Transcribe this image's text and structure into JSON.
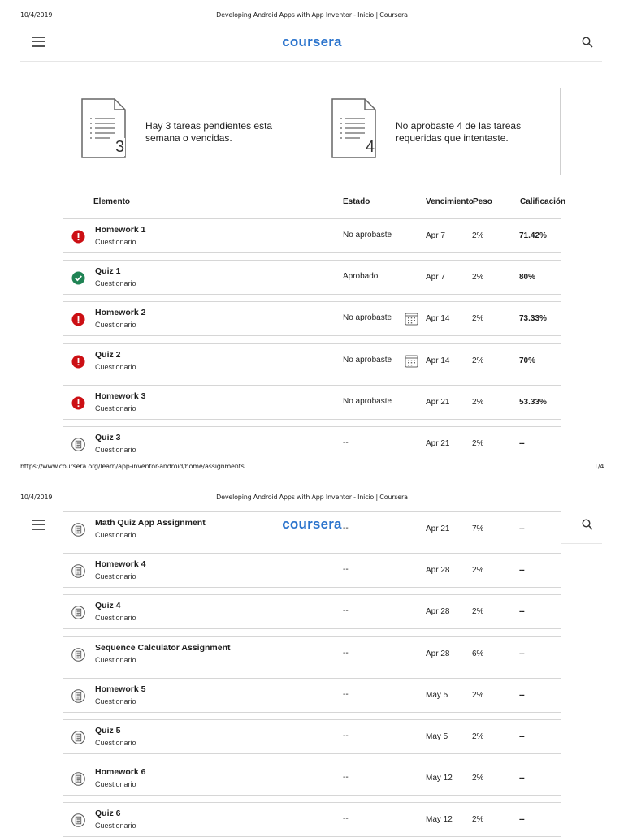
{
  "print": {
    "date": "10/4/2019",
    "title": "Developing Android Apps with App Inventor - Inicio | Coursera",
    "url": "https://www.coursera.org/learn/app-inventor-android/home/assignments",
    "page": "1/4"
  },
  "header": {
    "logo": "coursera"
  },
  "summary": {
    "pending_count": "3",
    "pending_text": "Hay 3 tareas pendientes esta semana o vencidas.",
    "failed_count": "4",
    "failed_text": "No aprobaste 4 de las tareas requeridas que intentaste."
  },
  "table": {
    "headers": {
      "item": "Elemento",
      "status": "Estado",
      "due": "Vencimiento",
      "weight": "Peso",
      "grade": "Calificación"
    },
    "rows_page1": [
      {
        "name": "Homework 1",
        "type": "Cuestionario",
        "status": "No aprobaste",
        "due": "Apr 7",
        "weight": "2%",
        "grade": "71.42%",
        "icon": "fail-icon",
        "calendar": false
      },
      {
        "name": "Quiz 1",
        "type": "Cuestionario",
        "status": "Aprobado",
        "due": "Apr 7",
        "weight": "2%",
        "grade": "80%",
        "icon": "check-icon",
        "calendar": false
      },
      {
        "name": "Homework 2",
        "type": "Cuestionario",
        "status": "No aprobaste",
        "due": "Apr 14",
        "weight": "2%",
        "grade": "73.33%",
        "icon": "fail-icon",
        "calendar": true
      },
      {
        "name": "Quiz 2",
        "type": "Cuestionario",
        "status": "No aprobaste",
        "due": "Apr 14",
        "weight": "2%",
        "grade": "70%",
        "icon": "fail-icon",
        "calendar": true
      },
      {
        "name": "Homework 3",
        "type": "Cuestionario",
        "status": "No aprobaste",
        "due": "Apr 21",
        "weight": "2%",
        "grade": "53.33%",
        "icon": "fail-icon",
        "calendar": false
      },
      {
        "name": "Quiz 3",
        "type": "Cuestionario",
        "status": "--",
        "due": "Apr 21",
        "weight": "2%",
        "grade": "--",
        "icon": "quiz-icon",
        "calendar": false
      }
    ],
    "rows_page2": [
      {
        "name": "Math Quiz App Assignment",
        "type": "Cuestionario",
        "status": "--",
        "due": "Apr 21",
        "weight": "7%",
        "grade": "--",
        "icon": "quiz-icon",
        "calendar": false
      },
      {
        "name": "Homework 4",
        "type": "Cuestionario",
        "status": "--",
        "due": "Apr 28",
        "weight": "2%",
        "grade": "--",
        "icon": "quiz-icon",
        "calendar": false
      },
      {
        "name": "Quiz 4",
        "type": "Cuestionario",
        "status": "--",
        "due": "Apr 28",
        "weight": "2%",
        "grade": "--",
        "icon": "quiz-icon",
        "calendar": false
      },
      {
        "name": "Sequence Calculator Assignment",
        "type": "Cuestionario",
        "status": "--",
        "due": "Apr 28",
        "weight": "6%",
        "grade": "--",
        "icon": "quiz-icon",
        "calendar": false
      },
      {
        "name": "Homework 5",
        "type": "Cuestionario",
        "status": "--",
        "due": "May 5",
        "weight": "2%",
        "grade": "--",
        "icon": "quiz-icon",
        "calendar": false
      },
      {
        "name": "Quiz 5",
        "type": "Cuestionario",
        "status": "--",
        "due": "May 5",
        "weight": "2%",
        "grade": "--",
        "icon": "quiz-icon",
        "calendar": false
      },
      {
        "name": "Homework 6",
        "type": "Cuestionario",
        "status": "--",
        "due": "May 12",
        "weight": "2%",
        "grade": "--",
        "icon": "quiz-icon",
        "calendar": false
      },
      {
        "name": "Quiz 6",
        "type": "Cuestionario",
        "status": "--",
        "due": "May 12",
        "weight": "2%",
        "grade": "--",
        "icon": "quiz-icon",
        "calendar": false
      }
    ]
  }
}
